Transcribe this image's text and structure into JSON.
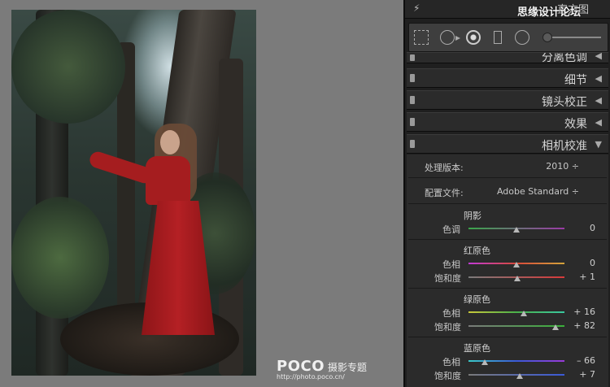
{
  "photo": {
    "watermark_brand": "POCO",
    "watermark_sub": "摄影专题",
    "watermark_url": "http://photo.poco.cn/"
  },
  "panel": {
    "histogram_title": "直方图",
    "site_watermark": "思缘设计论坛",
    "sections": [
      {
        "label": "分离色调"
      },
      {
        "label": "细节"
      },
      {
        "label": "镜头校正"
      },
      {
        "label": "效果"
      },
      {
        "label": "相机校准"
      }
    ],
    "process_label": "处理版本:",
    "process_value": "2010 ÷",
    "profile_label": "配置文件:",
    "profile_value": "Adobe Standard ÷",
    "shadow": {
      "title": "阴影",
      "tint_label": "色调",
      "tint_value": "0",
      "tint": 0
    },
    "red": {
      "title": "红原色",
      "hue_label": "色相",
      "hue_value": "0",
      "hue": 0,
      "sat_label": "饱和度",
      "sat_value": "+ 1",
      "sat": 1
    },
    "green": {
      "title": "绿原色",
      "hue_label": "色相",
      "hue_value": "+ 16",
      "hue": 16,
      "sat_label": "饱和度",
      "sat_value": "+ 82",
      "sat": 82
    },
    "blue": {
      "title": "蓝原色",
      "hue_label": "色相",
      "hue_value": "– 66",
      "hue": -66,
      "sat_label": "饱和度",
      "sat_value": "+ 7",
      "sat": 7
    },
    "colors": {
      "shadow_track": "#4aa04a",
      "red_track": "#c8474d",
      "green_track": "#5aa84a",
      "blue_track": "#4a63c8"
    }
  }
}
